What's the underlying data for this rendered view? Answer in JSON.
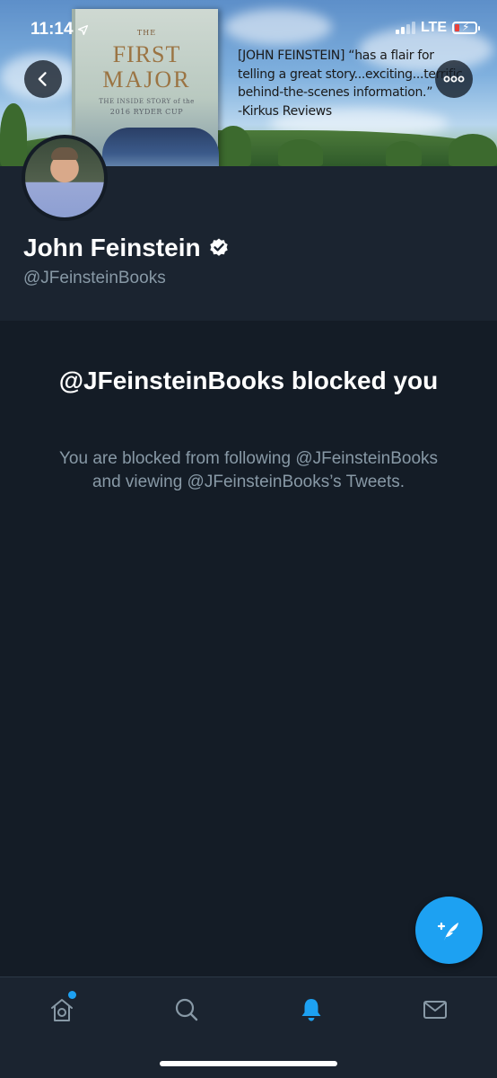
{
  "status_bar": {
    "time": "11:14",
    "network": "LTE"
  },
  "banner": {
    "book": {
      "the": "THE",
      "title_line1": "FIRST",
      "title_line2": "MAJOR",
      "subtitle_line1": "THE INSIDE STORY of the",
      "subtitle_line2": "2016 RYDER CUP"
    },
    "quote": {
      "line1": "[JOHN FEINSTEIN] “has a flair for",
      "line2": "telling a great story...exciting...terrific",
      "line3": "behind-the-scenes information.”",
      "line4": "-Kirkus Reviews"
    }
  },
  "profile": {
    "name": "John Feinstein",
    "handle": "@JFeinsteinBooks",
    "verified": true
  },
  "blocked": {
    "title": "@JFeinsteinBooks blocked you",
    "description": "You are blocked from following @JFeinsteinBooks and viewing @JFeinsteinBooks’s Tweets."
  },
  "tabs": [
    {
      "icon": "home-icon",
      "active": false,
      "has_badge": true
    },
    {
      "icon": "search-icon",
      "active": false,
      "has_badge": false
    },
    {
      "icon": "notifications-bell-icon",
      "active": true,
      "has_badge": false
    },
    {
      "icon": "messages-envelope-icon",
      "active": false,
      "has_badge": false
    }
  ],
  "colors": {
    "accent": "#1da1f2",
    "background": "#141c26",
    "header_background": "#1b2430",
    "secondary_text": "#8899a6",
    "battery_low": "#e8413a"
  }
}
